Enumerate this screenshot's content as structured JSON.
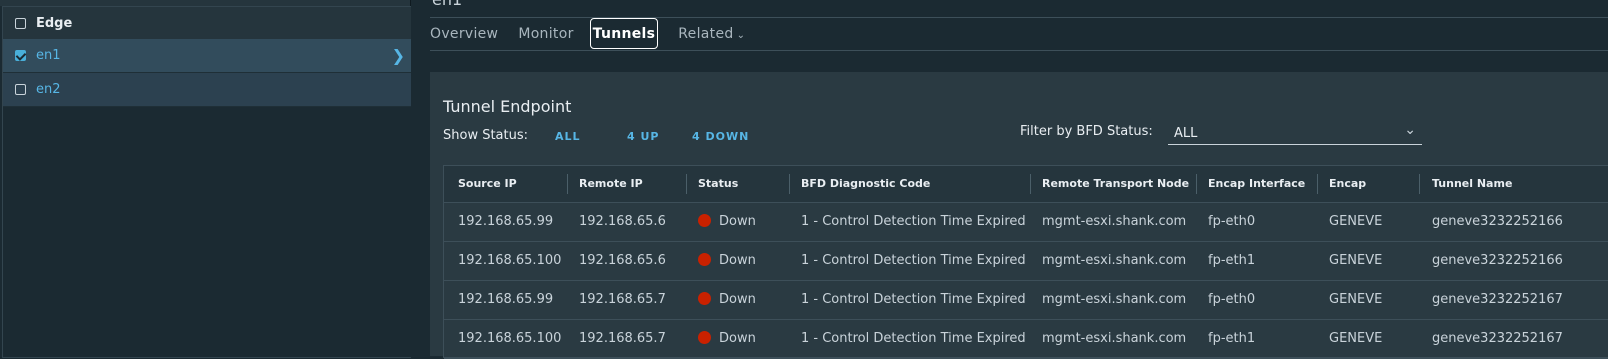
{
  "left_panel": {
    "header_label": "Edge",
    "rows": [
      {
        "label": "en1",
        "checked": true
      },
      {
        "label": "en2",
        "checked": false
      }
    ]
  },
  "title_fragment": "en1",
  "tabs": [
    {
      "label": "Overview"
    },
    {
      "label": "Monitor"
    },
    {
      "label": "Tunnels",
      "active": true
    },
    {
      "label": "Related"
    }
  ],
  "tunnel_endpoint": {
    "title": "Tunnel Endpoint",
    "show_status_label": "Show Status:",
    "status_options": [
      "ALL",
      "4 UP",
      "4 DOWN"
    ],
    "filter_label": "Filter by BFD Status:",
    "filter_value": "ALL"
  },
  "table": {
    "columns": [
      "Source IP",
      "Remote IP",
      "Status",
      "BFD Diagnostic Code",
      "Remote Transport Node",
      "Encap Interface",
      "Encap",
      "Tunnel Name"
    ],
    "rows": [
      [
        "192.168.65.99",
        "192.168.65.6",
        "Down",
        "1 - Control Detection Time Expired",
        "mgmt-esxi.shank.com",
        "fp-eth0",
        "GENEVE",
        "geneve3232252166"
      ],
      [
        "192.168.65.100",
        "192.168.65.6",
        "Down",
        "1 - Control Detection Time Expired",
        "mgmt-esxi.shank.com",
        "fp-eth1",
        "GENEVE",
        "geneve3232252166"
      ],
      [
        "192.168.65.99",
        "192.168.65.7",
        "Down",
        "1 - Control Detection Time Expired",
        "mgmt-esxi.shank.com",
        "fp-eth0",
        "GENEVE",
        "geneve3232252167"
      ],
      [
        "192.168.65.100",
        "192.168.65.7",
        "Down",
        "1 - Control Detection Time Expired",
        "mgmt-esxi.shank.com",
        "fp-eth1",
        "GENEVE",
        "geneve3232252167"
      ]
    ]
  },
  "colors": {
    "accent": "#57b6e5",
    "down_status": "#c92100",
    "background": "#1b2a32",
    "panel": "#2a3a42"
  },
  "icons": {
    "row_chevron": "chevron-right-icon",
    "dropdown": "chevron-down-icon",
    "status": "status-down-icon"
  }
}
